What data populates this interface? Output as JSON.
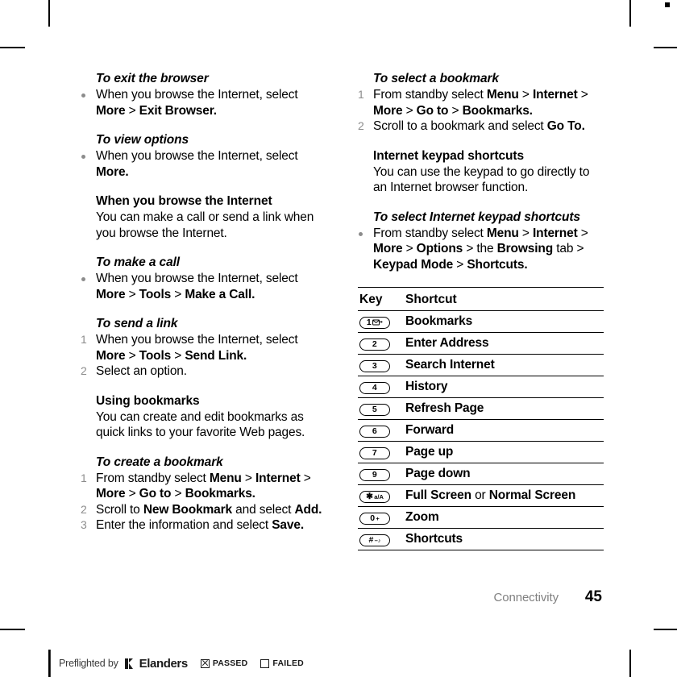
{
  "footer": {
    "chapter": "Connectivity",
    "page_number": "45"
  },
  "preflight": {
    "prefix": "Preflighted by",
    "brand": "Elanders",
    "passed_label": "PASSED",
    "failed_label": "FAILED",
    "passed_checked": true,
    "failed_checked": false
  },
  "left_column": {
    "s1": {
      "heading": "To exit the browser",
      "bullet1_a": "When you browse the Internet, select ",
      "bullet1_b": "More",
      "bullet1_gt": " > ",
      "bullet1_c": "Exit Browser."
    },
    "s2": {
      "heading": "To view options",
      "bullet1_a": "When you browse the Internet, select ",
      "bullet1_b": "More."
    },
    "s3": {
      "heading": "When you browse the Internet",
      "body": "You can make a call or send a link when you browse the Internet."
    },
    "s4": {
      "heading": "To make a call",
      "bullet1_a": "When you browse the Internet, select ",
      "bullet1_b": "More",
      "bullet1_gt1": " > ",
      "bullet1_c": "Tools",
      "bullet1_gt2": " > ",
      "bullet1_d": "Make a Call."
    },
    "s5": {
      "heading": "To send a link",
      "step1_num": "1",
      "step1_a": "When you browse the Internet, select ",
      "step1_b": "More",
      "step1_gt1": " > ",
      "step1_c": "Tools",
      "step1_gt2": " > ",
      "step1_d": "Send Link.",
      "step2_num": "2",
      "step2_a": "Select an option."
    },
    "s6": {
      "heading": "Using bookmarks",
      "body": "You can create and edit bookmarks as quick links to your favorite Web pages."
    },
    "s7": {
      "heading": "To create a bookmark",
      "step1_num": "1",
      "step1_a": "From standby select ",
      "step1_b": "Menu",
      "step1_gt1": " > ",
      "step1_c": "Internet",
      "step1_gt2": " > ",
      "step1_d": "More",
      "step1_gt3": " > ",
      "step1_e": "Go to",
      "step1_gt4": " > ",
      "step1_f": "Bookmarks.",
      "step2_num": "2",
      "step2_a": "Scroll to ",
      "step2_b": "New Bookmark",
      "step2_c": " and select ",
      "step2_d": "Add.",
      "step3_num": "3",
      "step3_a": "Enter the information and select ",
      "step3_b": "Save."
    }
  },
  "right_column": {
    "s1": {
      "heading": "To select a bookmark",
      "step1_num": "1",
      "step1_a": "From standby select ",
      "step1_b": "Menu",
      "step1_gt1": " > ",
      "step1_c": "Internet",
      "step1_gt2": " > ",
      "step1_d": "More",
      "step1_gt3": " > ",
      "step1_e": "Go to",
      "step1_gt4": " > ",
      "step1_f": "Bookmarks.",
      "step2_num": "2",
      "step2_a": "Scroll to a bookmark and select ",
      "step2_b": "Go To."
    },
    "s2": {
      "heading": "Internet keypad shortcuts",
      "body": "You can use the keypad to go directly to an Internet browser function."
    },
    "s3": {
      "heading": "To select Internet keypad shortcuts",
      "bullet1_a": "From standby select ",
      "bullet1_b": "Menu",
      "bullet1_gt1": " > ",
      "bullet1_c": "Internet",
      "bullet1_gt2": " > ",
      "bullet1_d": "More",
      "bullet1_gt3": " > ",
      "bullet1_e": "Options",
      "bullet1_gt4": " > the ",
      "bullet1_f": "Browsing",
      "bullet1_g": " tab > ",
      "bullet1_h": "Keypad Mode",
      "bullet1_gt5": " > ",
      "bullet1_i": "Shortcuts."
    },
    "table": {
      "headers": [
        "Key",
        "Shortcut"
      ],
      "rows": [
        {
          "key_label": "1",
          "key_icon": "envelope-icon",
          "shortcut": "Bookmarks"
        },
        {
          "key_label": "2",
          "key_icon": "",
          "shortcut": "Enter Address"
        },
        {
          "key_label": "3",
          "key_icon": "",
          "shortcut": "Search Internet"
        },
        {
          "key_label": "4",
          "key_icon": "",
          "shortcut": "History"
        },
        {
          "key_label": "5",
          "key_icon": "",
          "shortcut": "Refresh Page"
        },
        {
          "key_label": "6",
          "key_icon": "",
          "shortcut": "Forward"
        },
        {
          "key_label": "7",
          "key_icon": "",
          "shortcut": "Page up"
        },
        {
          "key_label": "9",
          "key_icon": "",
          "shortcut": "Page down"
        },
        {
          "key_label": "✱",
          "key_sub": "a/A",
          "key_icon": "",
          "shortcut_a": "Full Screen",
          "shortcut_or": " or ",
          "shortcut_b": "Normal Screen"
        },
        {
          "key_label": "0",
          "key_sub": "+",
          "key_icon": "",
          "shortcut": "Zoom"
        },
        {
          "key_label": "#",
          "key_sub": "–♪",
          "key_icon": "",
          "shortcut": "Shortcuts"
        }
      ]
    }
  }
}
